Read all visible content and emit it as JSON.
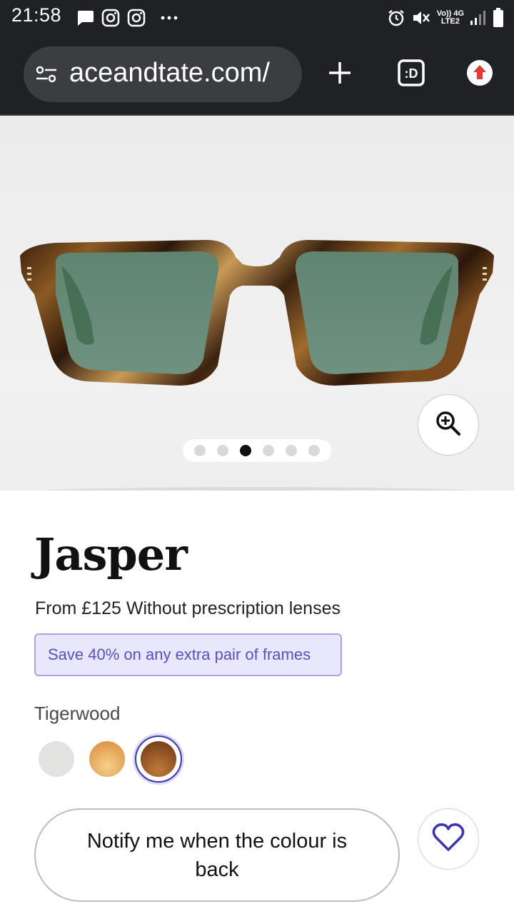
{
  "status_bar": {
    "time": "21:58",
    "network_line1": "Vo)) 4G",
    "network_line2": "LTE2",
    "icons": [
      "message-icon",
      "instagram-icon",
      "instagram-icon",
      "more-icon",
      "alarm-icon",
      "mute-icon",
      "signal-icon",
      "battery-icon"
    ]
  },
  "browser": {
    "url": "aceandtate.com/",
    "icons": [
      "tune-icon",
      "new-tab-icon",
      "tab-switcher-icon",
      "update-icon"
    ]
  },
  "gallery": {
    "slide_count": 6,
    "active_slide": 3,
    "zoom_icon": "zoom-in-icon"
  },
  "product": {
    "name": "Jasper",
    "price_prefix": "From",
    "price": "£125",
    "price_suffix": "Without prescription lenses",
    "promo": "Save 40% on any extra pair of frames",
    "colour_name": "Tigerwood",
    "swatches": [
      {
        "name": "clear",
        "color": "#e3e4e2",
        "selected": false
      },
      {
        "name": "honey",
        "color": "#e8a85a",
        "selected": false
      },
      {
        "name": "tigerwood",
        "color": "#8a4f1e",
        "selected": true
      }
    ],
    "notify_label": "Notify me when the colour is back",
    "favourite_icon": "heart-icon"
  },
  "colors": {
    "accent": "#3b33b8",
    "promo_bg": "#e9e7fb",
    "promo_text": "#5a4fc4",
    "chrome_bg": "#202124"
  }
}
